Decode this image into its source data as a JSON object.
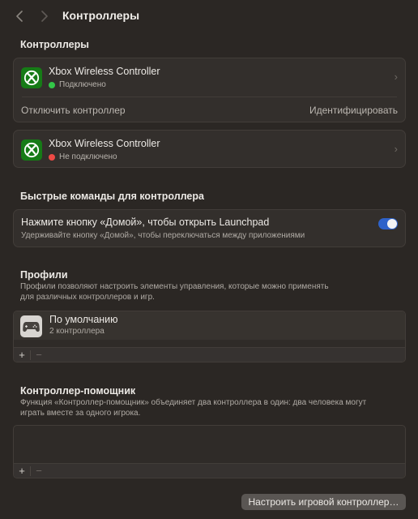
{
  "header": {
    "title": "Контроллеры"
  },
  "controllers_section": {
    "title": "Контроллеры",
    "devices": [
      {
        "name": "Xbox Wireless Controller",
        "status": "Подключено",
        "status_color": "#33c748",
        "icon": "xbox-logo-icon"
      },
      {
        "name": "Xbox Wireless Controller",
        "status": "Не подключено",
        "status_color": "#ee4a45",
        "icon": "xbox-logo-icon"
      }
    ],
    "disconnect_label": "Отключить контроллер",
    "identify_label": "Идентифицировать"
  },
  "shortcuts_section": {
    "title": "Быстрые команды для контроллера",
    "home_title": "Нажмите кнопку «Домой», чтобы открыть Launchpad",
    "home_subtitle": "Удерживайте кнопку «Домой», чтобы переключаться между приложениями",
    "home_enabled": true
  },
  "profiles_section": {
    "title": "Профили",
    "description_line1": "Профили позволяют настроить элементы управления, которые можно применять",
    "description_line2": "для различных контроллеров и игр.",
    "items": [
      {
        "name": "По умолчанию",
        "subtitle": "2 контроллера",
        "icon": "gamepad-icon"
      }
    ],
    "add_label": "+",
    "remove_label": "−"
  },
  "assistant_section": {
    "title": "Контроллер-помощник",
    "description_line1": "Функция «Контроллер-помощник» объединяет два контроллера в один: два человека могут",
    "description_line2": "играть вместе за одного игрока.",
    "add_label": "+",
    "remove_label": "−"
  },
  "footer": {
    "configure_label": "Настроить игровой контроллер…"
  },
  "colors": {
    "accent": "#2e62c9",
    "xbox_green": "#167b16",
    "background": "#2b2724"
  }
}
